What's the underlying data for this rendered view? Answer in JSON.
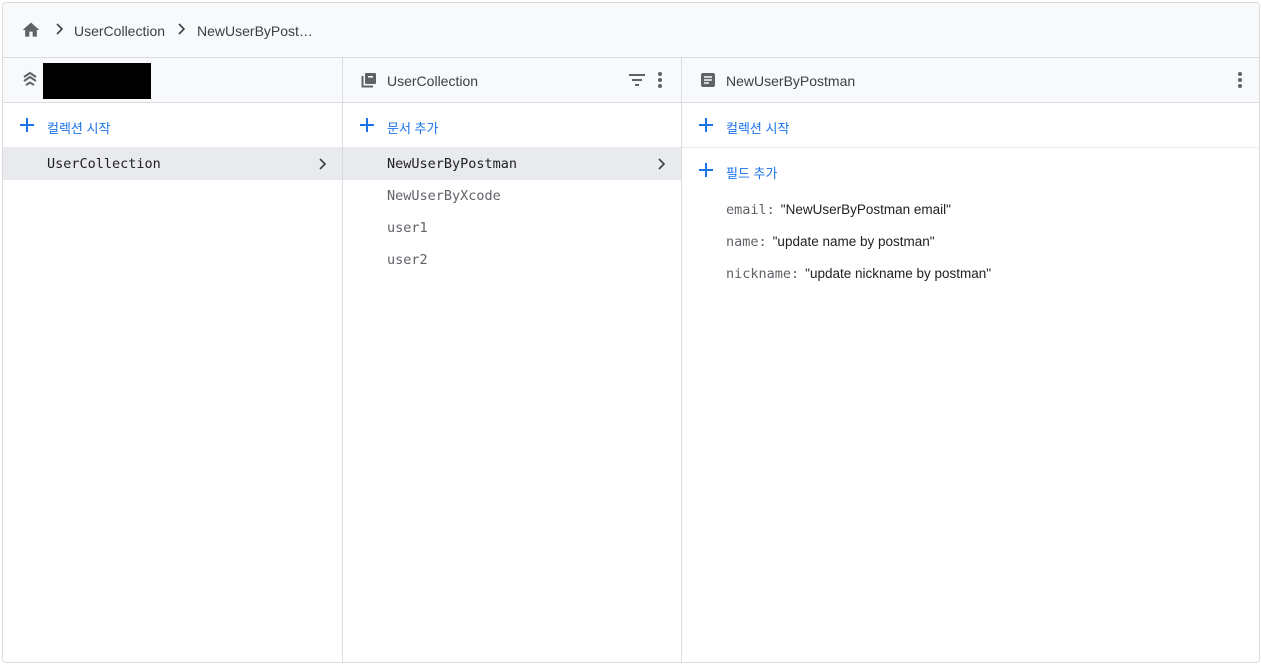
{
  "breadcrumb": {
    "home_icon": "home-icon",
    "items": [
      "UserCollection",
      "NewUserByPost…"
    ]
  },
  "root_panel": {
    "logo_icon": "firestore-icon",
    "add_collection_label": "컬렉션 시작",
    "items": [
      {
        "label": "UserCollection",
        "selected": true
      }
    ]
  },
  "collection_panel": {
    "title": "UserCollection",
    "icon": "collection-icon",
    "filter_icon": "filter-icon",
    "menu_icon": "more-vert-icon",
    "add_document_label": "문서 추가",
    "documents": [
      {
        "label": "NewUserByPostman",
        "selected": true
      },
      {
        "label": "NewUserByXcode",
        "selected": false
      },
      {
        "label": "user1",
        "selected": false
      },
      {
        "label": "user2",
        "selected": false
      }
    ]
  },
  "document_panel": {
    "title": "NewUserByPostman",
    "icon": "document-icon",
    "menu_icon": "more-vert-icon",
    "add_collection_label": "컬렉션 시작",
    "add_field_label": "필드 추가",
    "fields": [
      {
        "key": "email:",
        "value": "\"NewUserByPostman email\""
      },
      {
        "key": "name:",
        "value": "\"update name by postman\""
      },
      {
        "key": "nickname:",
        "value": "\"update nickname by postman\""
      }
    ]
  },
  "colors": {
    "accent": "#1a73e8",
    "border": "#dadce0",
    "header_bg": "#f8f9fa",
    "selected_bg": "#e8eaed"
  }
}
